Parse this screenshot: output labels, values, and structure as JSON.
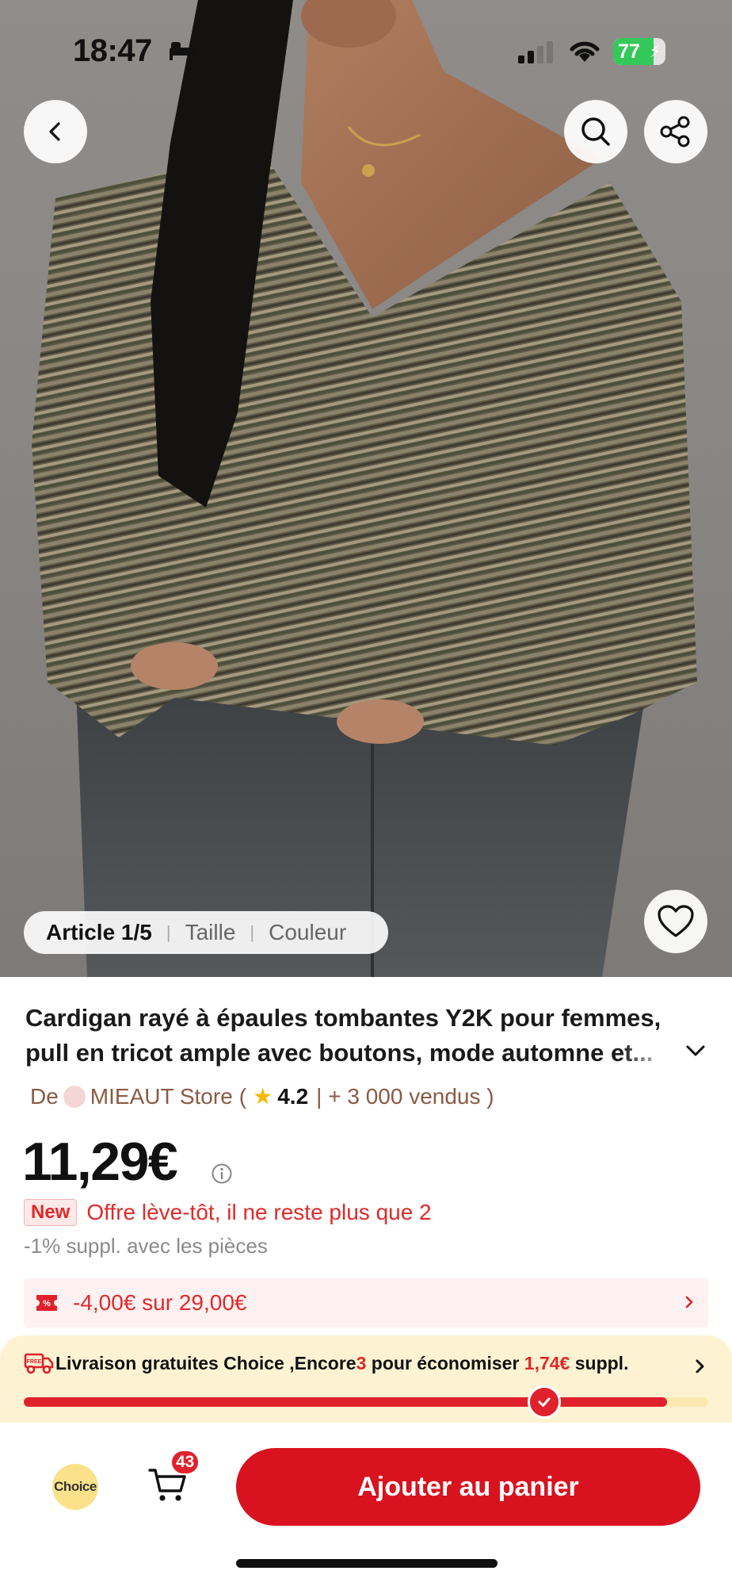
{
  "status_bar": {
    "time": "18:47",
    "battery": "77",
    "battery_level": 0.77,
    "sleep_icon": "bed-icon"
  },
  "nav": {
    "back_icon": "chevron-left-icon",
    "search_icon": "search-icon",
    "share_icon": "share-icon",
    "favorite_icon": "heart-icon"
  },
  "gallery": {
    "active": "Article 1/5",
    "tabs": [
      "Taille",
      "Couleur"
    ]
  },
  "product": {
    "title_line1": "Cardigan rayé à épaules tombantes Y2K pour femmes,",
    "title_line2": "pull en tricot ample avec boutons, mode automne et..."
  },
  "store": {
    "prefix": "De",
    "name": "MIEAUT Store",
    "open": "(",
    "rating": "4.2",
    "sold": "| + 3 000 vendus )"
  },
  "price": {
    "value": "11,29€"
  },
  "promo": {
    "badge": "New",
    "text": "Offre lève-tôt, il ne reste plus que 2"
  },
  "coins": "-1% suppl. avec les pièces",
  "coupon": {
    "text": "-4,00€ sur 29,00€"
  },
  "shipping": {
    "part1": "Livraison gratuites Choice ,Encore ",
    "count": "3",
    "part2": " pour économiser ",
    "amount": "1,74€",
    "part3": " suppl.",
    "progress": 0.94,
    "milestone": 0.76
  },
  "bottom": {
    "choice_label": "Choice",
    "cart_count": "43",
    "add_to_cart": "Ajouter au panier"
  },
  "colors": {
    "accent_red": "#d8131f",
    "shipping_bg": "#fdf3d3",
    "coupon_bg": "#fdf1f2",
    "store_brown": "#8a5a44"
  }
}
